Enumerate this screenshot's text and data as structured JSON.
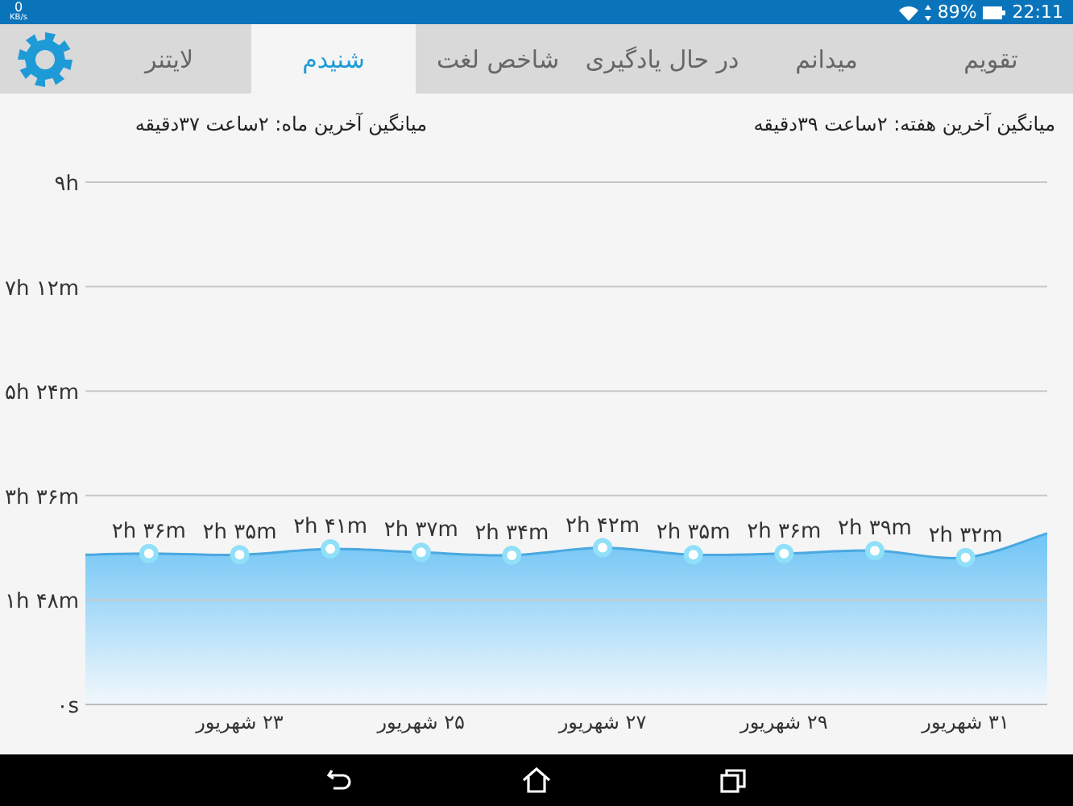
{
  "status_bar": {
    "speed_value": "0",
    "speed_unit": "KB/s",
    "battery": "89%",
    "time": "22:11"
  },
  "tabs": [
    {
      "label": "تقویم",
      "selected": false
    },
    {
      "label": "میدانم",
      "selected": false
    },
    {
      "label": "در حال یادگیری",
      "selected": false
    },
    {
      "label": "شاخص لغت",
      "selected": false
    },
    {
      "label": "شنیدم",
      "selected": true
    },
    {
      "label": "لایتنر",
      "selected": false
    }
  ],
  "summary": {
    "week": "میانگین آخرین هفته: ۲ساعت  ۳۹دقیقه",
    "month": "میانگین آخرین ماه: ۲ساعت  ۳۷دقیقه"
  },
  "chart": {
    "chart_data": {
      "type": "area",
      "x": [
        21.3,
        22,
        23,
        24,
        25,
        26,
        27,
        28,
        29,
        30,
        31,
        31.9
      ],
      "xlim": [
        21.3,
        31.9
      ],
      "ylim": [
        0,
        9
      ],
      "grid": true,
      "series": [
        {
          "color": "#4aa8e0",
          "values": [
            2.58,
            2.6,
            2.58,
            2.68,
            2.62,
            2.57,
            2.7,
            2.58,
            2.6,
            2.65,
            2.53,
            2.95
          ]
        }
      ],
      "value_labels": [
        null,
        "۲h ۳۶m",
        "۲h ۳۵m",
        "۲h ۴۱m",
        "۲h ۳۷m",
        "۲h ۳۴m",
        "۲h ۴۲m",
        "۲h ۳۵m",
        "۲h ۳۶m",
        "۲h ۳۹m",
        "۲h ۳۲m",
        null
      ],
      "yticks": [
        {
          "value": 0,
          "label": "۰s"
        },
        {
          "value": 1.8,
          "label": "۱h ۴۸m"
        },
        {
          "value": 3.6,
          "label": "۳h ۳۶m"
        },
        {
          "value": 5.4,
          "label": "۵h ۲۴m"
        },
        {
          "value": 7.2,
          "label": "۷h ۱۲m"
        },
        {
          "value": 9,
          "label": "۹h"
        }
      ],
      "xticks": [
        {
          "value": 23,
          "label": "۲۳ شهریور"
        },
        {
          "value": 25,
          "label": "۲۵ شهریور"
        },
        {
          "value": 27,
          "label": "۲۷ شهریور"
        },
        {
          "value": 29,
          "label": "۲۹ شهریور"
        },
        {
          "value": 31,
          "label": "۳۱ شهریور"
        }
      ]
    }
  }
}
